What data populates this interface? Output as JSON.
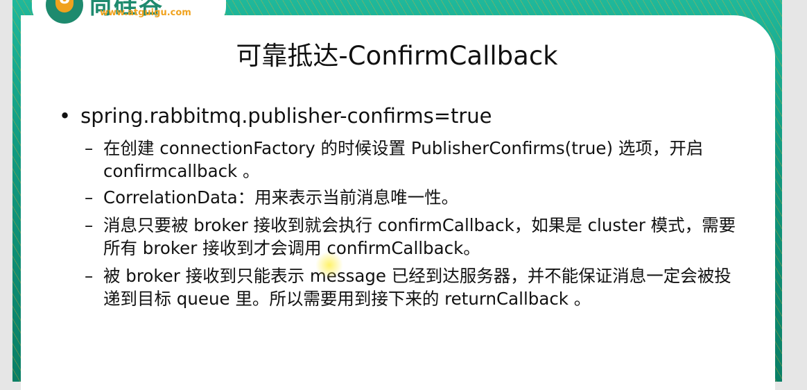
{
  "logo": {
    "brand": "尚硅谷",
    "url": "www.atguigu.com",
    "mark": "U"
  },
  "title": "可靠抵达-ConfirmCallback",
  "bullet": "spring.rabbitmq.publisher-confirms=true",
  "subitems": [
    "在创建 connectionFactory 的时候设置 PublisherConfirms(true) 选项，开启 confirmcallback 。",
    "CorrelationData：用来表示当前消息唯一性。",
    "消息只要被 broker 接收到就会执行 confirmCallback，如果是 cluster 模式，需要所有 broker 接收到才会调用 confirmCallback。",
    "被 broker 接收到只能表示 message 已经到达服务器，并不能保证消息一定会被投递到目标 queue 里。所以需要用到接下来的 returnCallback 。"
  ],
  "colors": {
    "frame": "#129a80",
    "accent": "#f0a21e"
  }
}
